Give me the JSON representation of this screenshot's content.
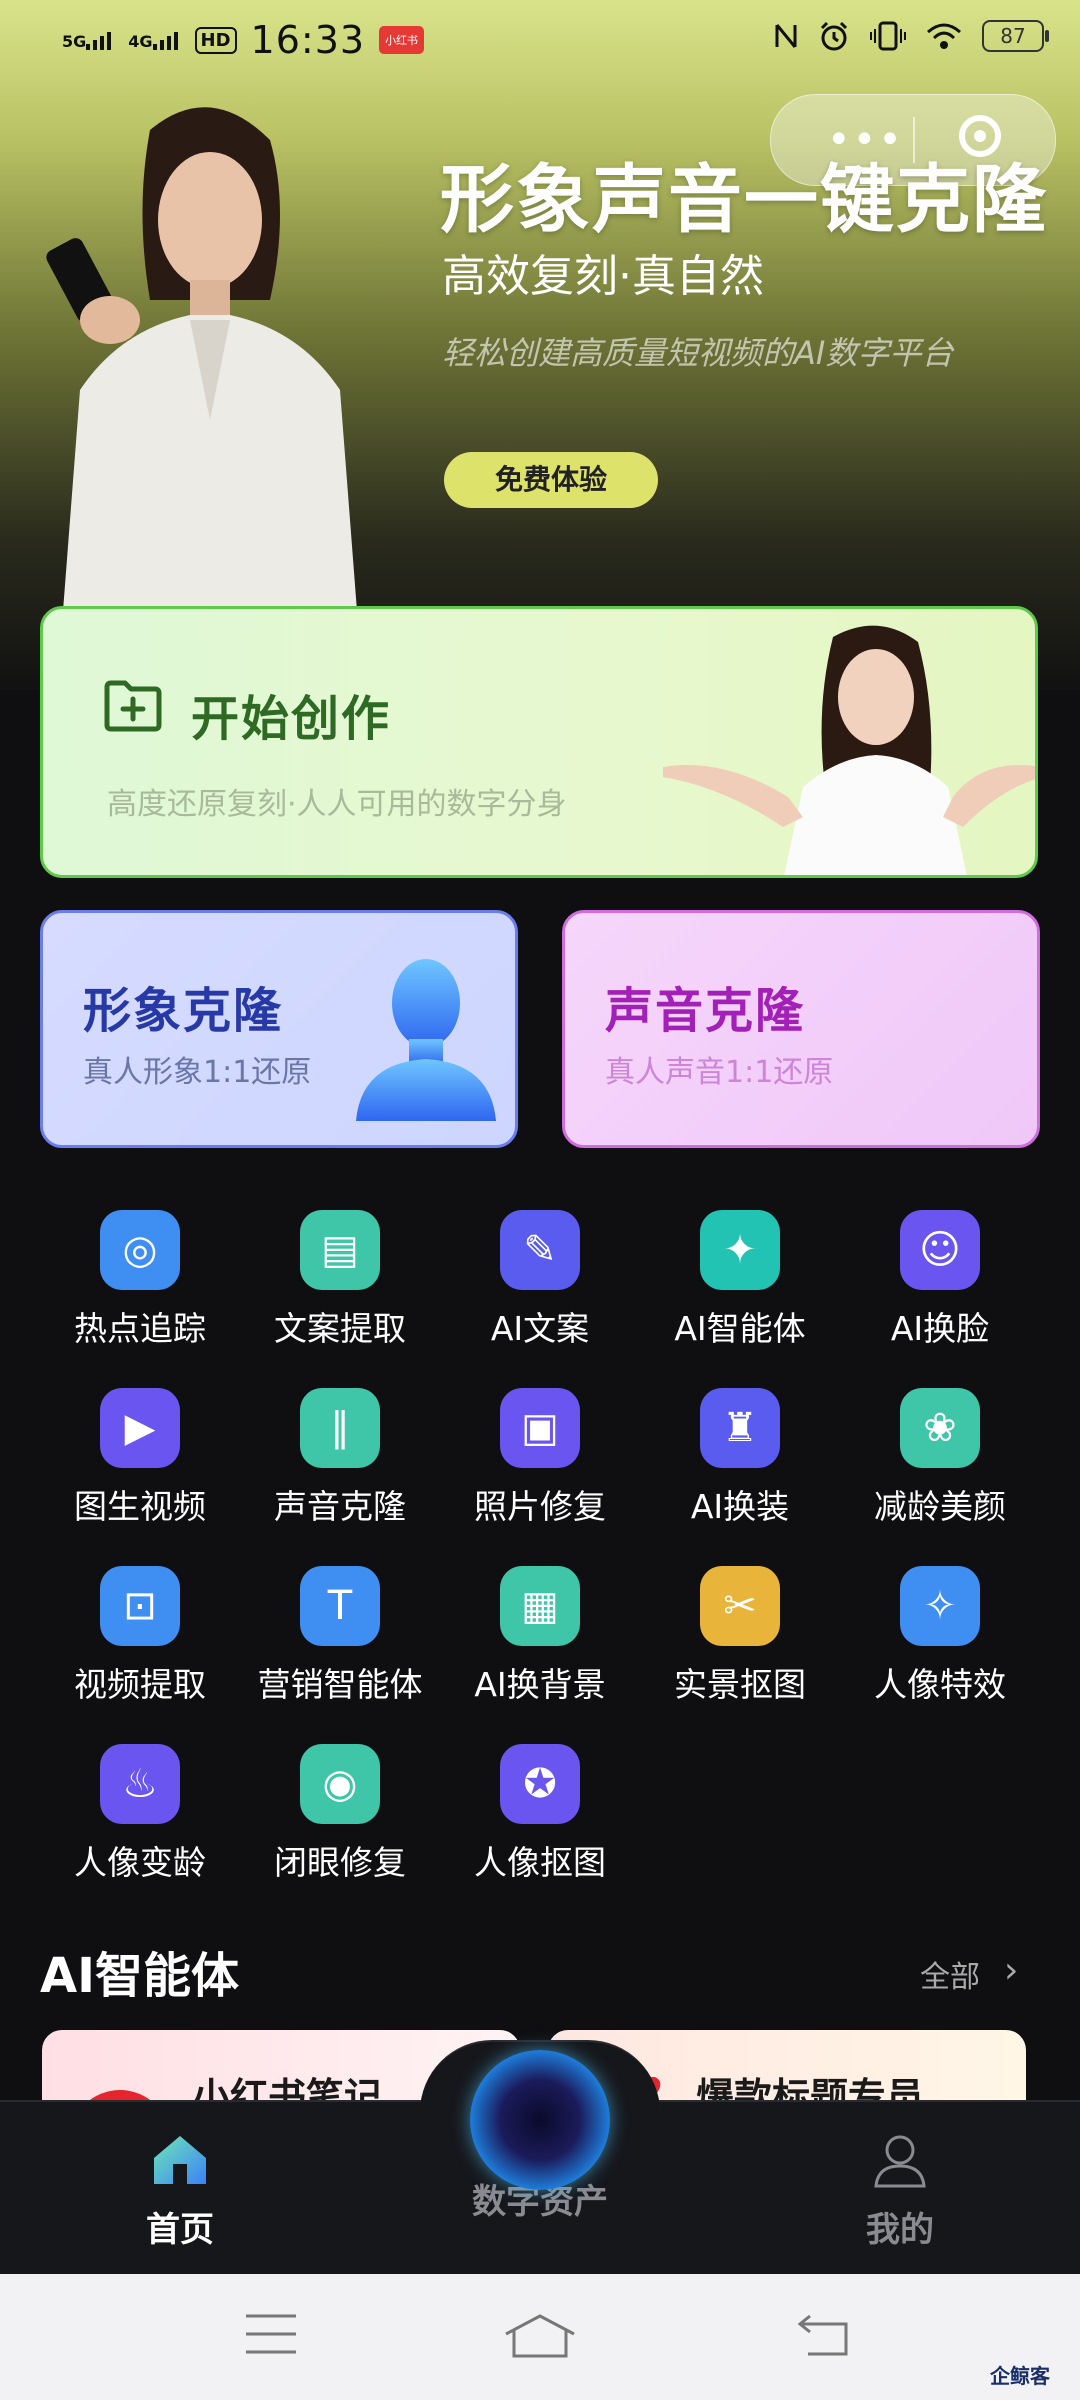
{
  "status_bar": {
    "sig1": "5G",
    "sig2": "4G",
    "hd": "HD",
    "time": "16:33",
    "badge": "小红书",
    "battery": "87"
  },
  "capsule": {
    "more_icon": "more-dots-icon",
    "close_icon": "target-close-icon"
  },
  "hero": {
    "title": "形象声音一键克隆",
    "subtitle": "高效复刻·真自然",
    "description": "轻松创建高质量短视频的AI数字平台",
    "button": "免费体验"
  },
  "create_card": {
    "title": "开始创作",
    "subtitle": "高度还原复刻·人人可用的数字分身"
  },
  "clone_cards": [
    {
      "title": "形象克隆",
      "subtitle": "真人形象1:1还原"
    },
    {
      "title": "声音克隆",
      "subtitle": "真人声音1:1还原"
    }
  ],
  "tools": [
    {
      "label": "热点追踪",
      "icon": "target-icon",
      "color": "#3f8ff2"
    },
    {
      "label": "文案提取",
      "icon": "document-extract-icon",
      "color": "#3fc6a8"
    },
    {
      "label": "AI文案",
      "icon": "pen-icon",
      "color": "#5a5cf0"
    },
    {
      "label": "AI智能体",
      "icon": "sparkle-icon",
      "color": "#23c3b3"
    },
    {
      "label": "AI换脸",
      "icon": "face-swap-icon",
      "color": "#6a55f0"
    },
    {
      "label": "图生视频",
      "icon": "play-video-icon",
      "color": "#6a55f0"
    },
    {
      "label": "声音克隆",
      "icon": "soundwave-icon",
      "color": "#3fc6a8"
    },
    {
      "label": "照片修复",
      "icon": "photo-repair-icon",
      "color": "#6a55f0"
    },
    {
      "label": "AI换装",
      "icon": "outfit-icon",
      "color": "#5a5cf0"
    },
    {
      "label": "减龄美颜",
      "icon": "beauty-face-icon",
      "color": "#3fc6a8"
    },
    {
      "label": "视频提取",
      "icon": "video-extract-icon",
      "color": "#3f8ff2"
    },
    {
      "label": "营销智能体",
      "icon": "text-agent-icon",
      "color": "#3f8ff2"
    },
    {
      "label": "AI换背景",
      "icon": "background-swap-icon",
      "color": "#3fc6a8"
    },
    {
      "label": "实景抠图",
      "icon": "scene-cutout-icon",
      "color": "#e9b43a"
    },
    {
      "label": "人像特效",
      "icon": "portrait-effect-icon",
      "color": "#3f8ff2"
    },
    {
      "label": "人像变龄",
      "icon": "cake-icon",
      "color": "#6a55f0"
    },
    {
      "label": "闭眼修复",
      "icon": "eye-repair-icon",
      "color": "#3fc6a8"
    },
    {
      "label": "人像抠图",
      "icon": "magic-cutout-icon",
      "color": "#6a55f0"
    }
  ],
  "agents_section": {
    "title": "AI智能体",
    "all_label": "全部",
    "cards": [
      {
        "title": "小红书笔记"
      },
      {
        "title": "爆款标题专员"
      }
    ]
  },
  "tabbar": {
    "tabs": [
      {
        "label": "首页",
        "icon": "home-icon",
        "active": true
      },
      {
        "label": "数字资产",
        "icon": "orb-icon",
        "active": false
      },
      {
        "label": "我的",
        "icon": "user-icon",
        "active": false
      }
    ],
    "active_color": "#ffffff",
    "inactive_color": "#8a8b90"
  },
  "system_nav": {
    "menu_icon": "menu-icon",
    "home_icon": "home-outline-icon",
    "back_icon": "back-icon"
  },
  "watermark": "企鲸客"
}
